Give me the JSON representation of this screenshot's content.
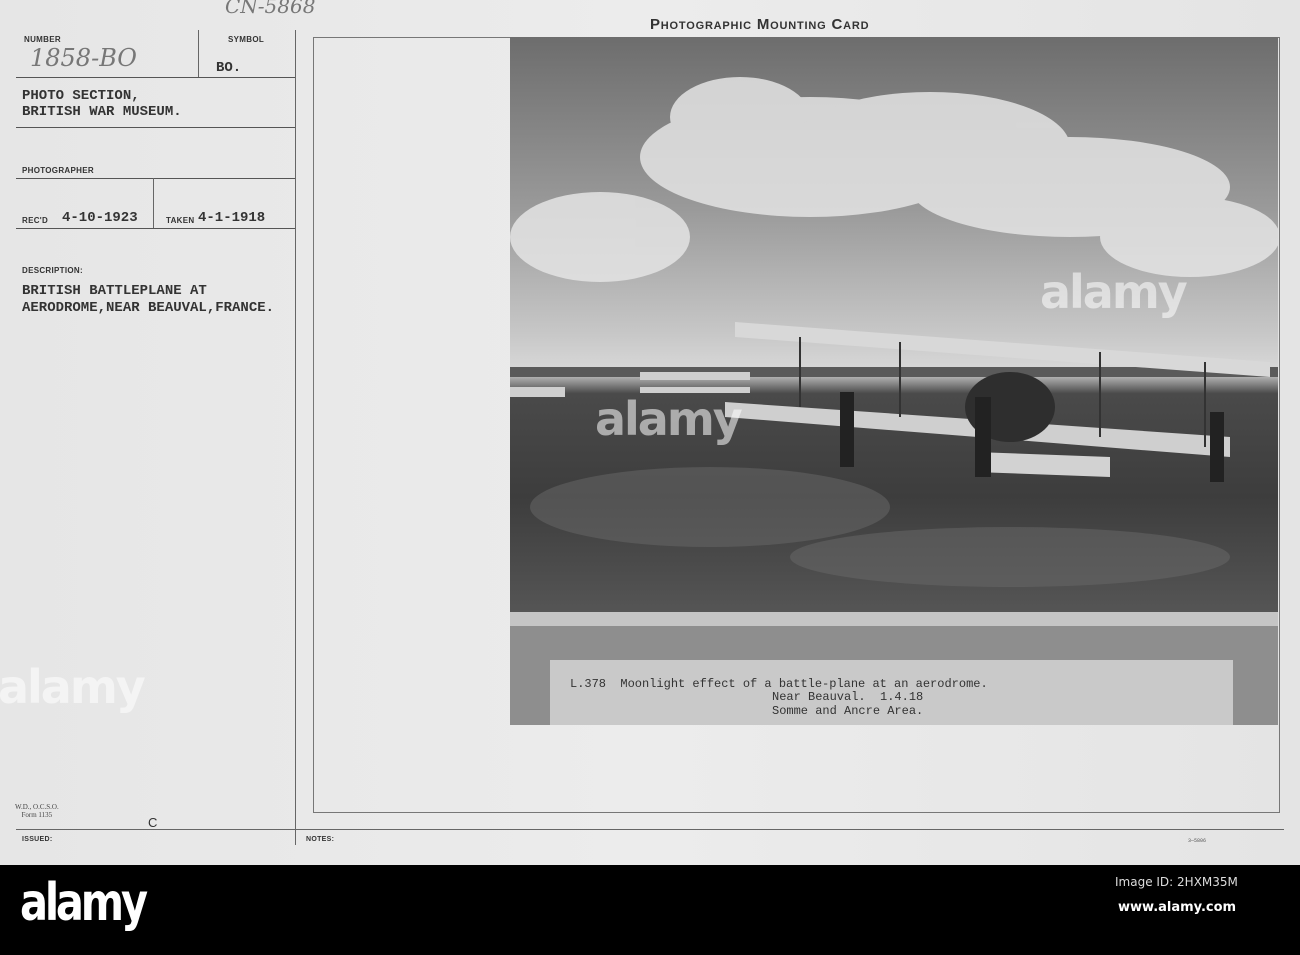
{
  "card": {
    "handwritten_ref": "CN-5868",
    "number_label": "NUMBER",
    "number_value": "1858-BO",
    "symbol_label": "SYMBOL",
    "symbol_value": "BO.",
    "section_line1": "PHOTO SECTION,",
    "section_line2": "BRITISH WAR MUSEUM.",
    "photographer_label": "PHOTOGRAPHER",
    "recd_label": "REC'D",
    "recd_value": "4-10-1923",
    "taken_label": "TAKEN",
    "taken_value": "4-1-1918",
    "description_label": "DESCRIPTION:",
    "description_line1": "BRITISH BATTLEPLANE AT",
    "description_line2": "AERODROME,NEAR BEAUVAL,FRANCE.",
    "form_line1": "W.D., O.C.S.O.",
    "form_line2": "Form 1135",
    "form_letter": "C",
    "issued_label": "ISSUED:",
    "notes_label": "NOTES:",
    "print_code": "3—5806",
    "title": "Photographic Mounting Card"
  },
  "photo_caption": {
    "line1": "L.378  Moonlight effect of a battle-plane at an aerodrome.",
    "line2": "Near Beauval.  1.4.18",
    "line3": "Somme and Ancre Area."
  },
  "watermark": {
    "text": "alamy"
  },
  "footer": {
    "logo": "alamy",
    "image_id": "Image ID: 2HXM35M",
    "url": "www.alamy.com"
  }
}
